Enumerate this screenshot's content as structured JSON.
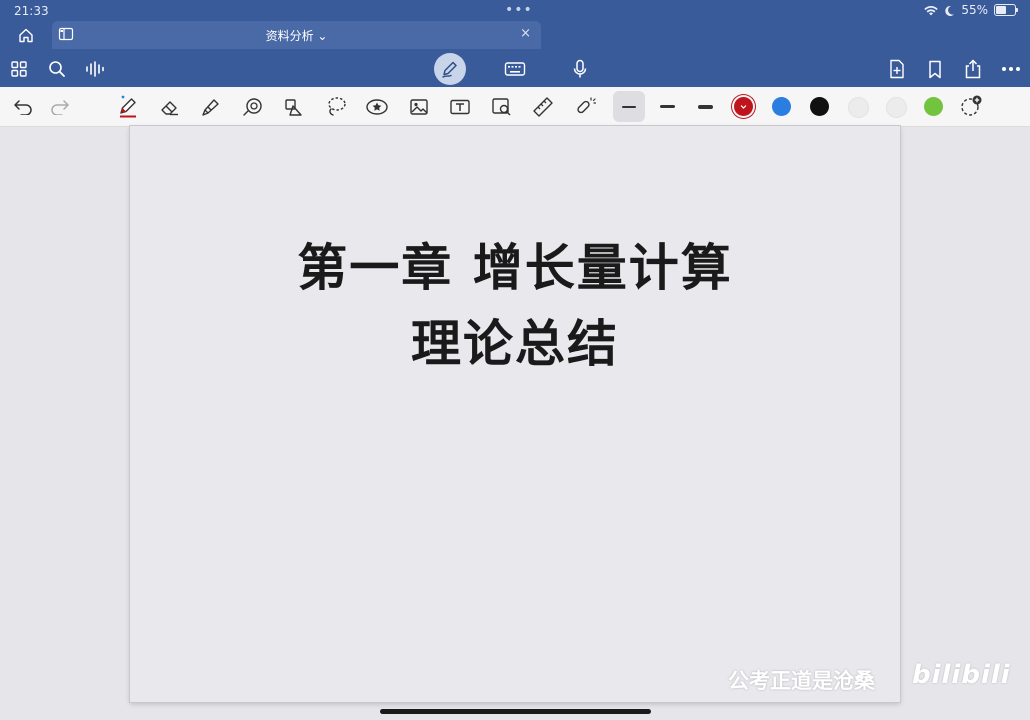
{
  "status": {
    "time": "21:33",
    "battery": "55%",
    "battery_level": 0.55
  },
  "tab": {
    "title": "资料分析 ⌄",
    "close": "×"
  },
  "document": {
    "title_line1": "第一章 增长量计算",
    "title_line2": "理论总结"
  },
  "watermark": {
    "text": "公考正道是沧桑",
    "logo": "bilibili"
  },
  "colors": {
    "topbar": "#3a5b9a",
    "swatches": [
      "#c0141d",
      "#2a7de1",
      "#111111",
      "#ececec",
      "#ececec",
      "#72c43f"
    ]
  },
  "icons": {
    "nav": [
      "home-icon",
      "grid-icon",
      "search-icon",
      "audio-icon",
      "pen-mode-icon",
      "keyboard-icon",
      "microphone-icon",
      "add-page-icon",
      "bookmark-icon",
      "share-icon",
      "more-icon"
    ],
    "tools": [
      "undo-icon",
      "redo-icon",
      "pen-icon",
      "eraser-icon",
      "highlighter-icon",
      "shape-icon",
      "element-icon",
      "lasso-icon",
      "sticker-icon",
      "image-icon",
      "text-box-icon",
      "image-search-icon",
      "ruler-icon",
      "laser-pointer-icon"
    ]
  }
}
